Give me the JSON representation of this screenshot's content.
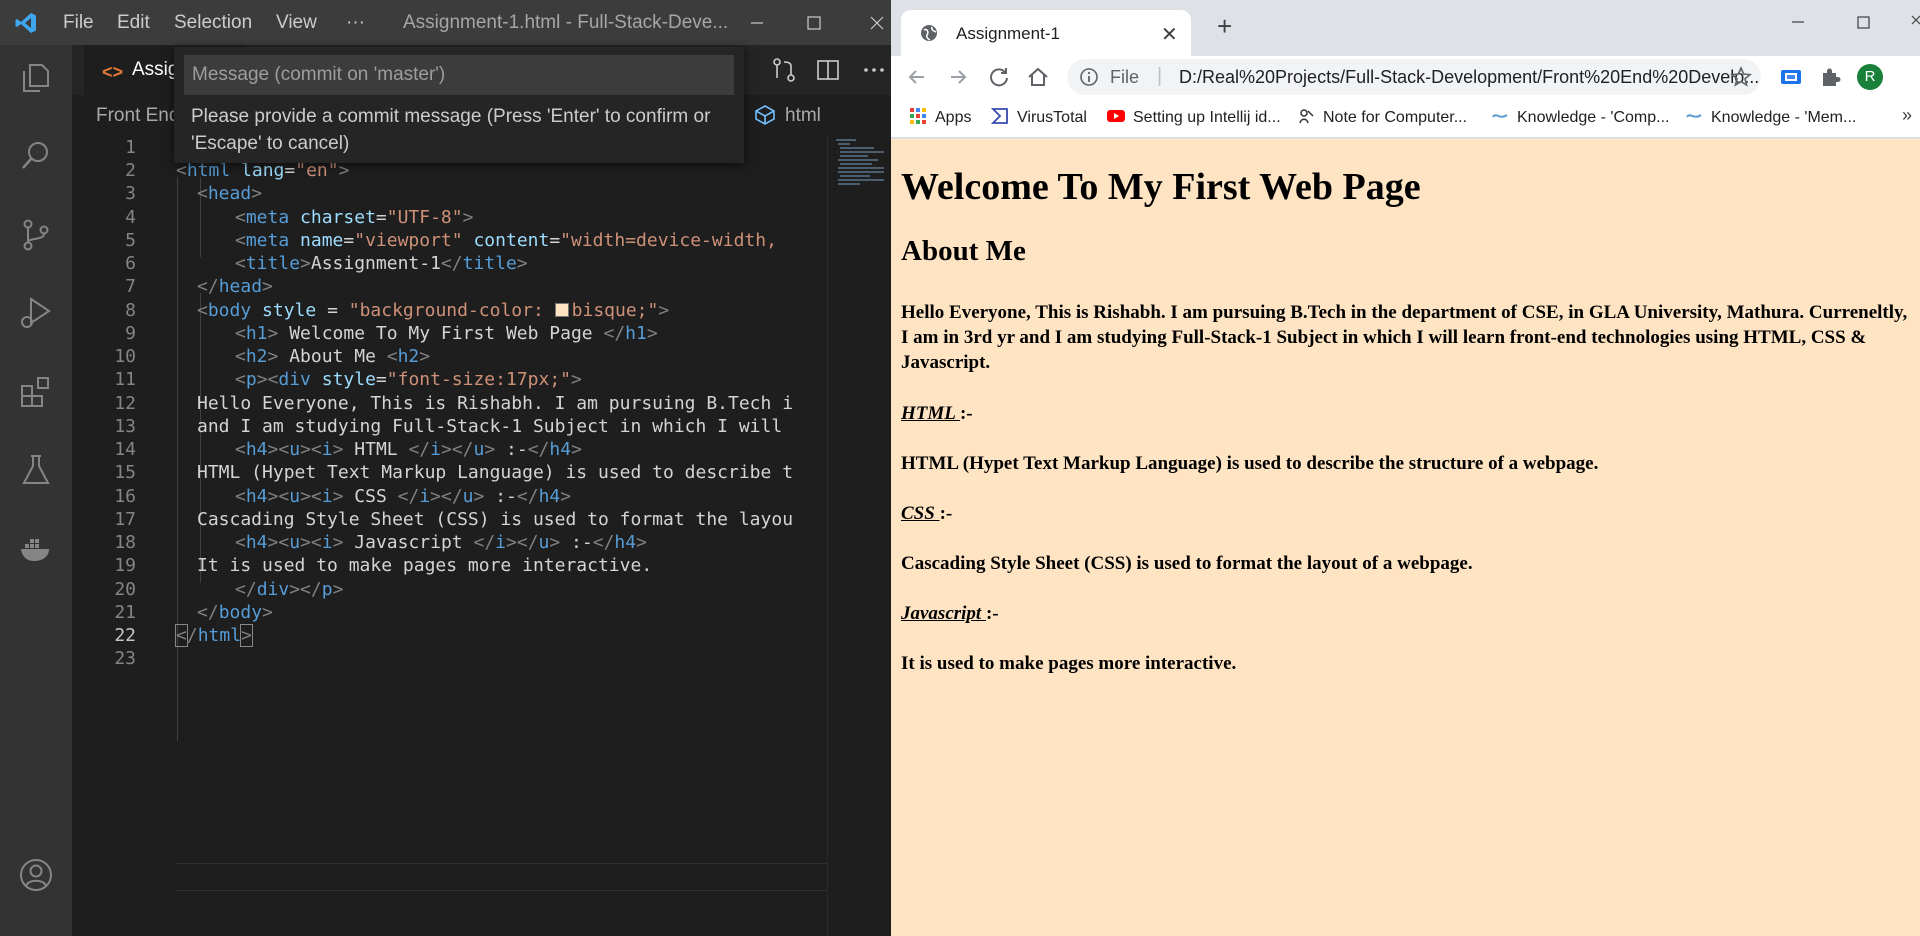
{
  "vscode": {
    "menu": [
      "File",
      "Edit",
      "Selection",
      "View",
      "···"
    ],
    "window_title": "Assignment-1.html - Full-Stack-Deve...",
    "tab_label": "Assign",
    "tab_icon": "<>",
    "breadcrumb_left": "Front End",
    "breadcrumb_right": "html",
    "commit_placeholder": "Message (commit on 'master')",
    "commit_help": "Please provide a commit message (Press 'Enter' to confirm or 'Escape' to cancel)",
    "activity_icons": [
      "explorer-icon",
      "search-icon",
      "source-control-icon",
      "run-debug-icon",
      "extensions-icon",
      "testing-icon",
      "docker-icon",
      "account-icon"
    ],
    "line_numbers": [
      "1",
      "2",
      "3",
      "4",
      "5",
      "6",
      "7",
      "8",
      "9",
      "10",
      "11",
      "12",
      "13",
      "14",
      "15",
      "16",
      "17",
      "18",
      "19",
      "20",
      "21",
      "22",
      "23"
    ],
    "code": {
      "l2_tag": "html",
      "l2_attr": "lang",
      "l2_val": "\"en\"",
      "l3_tag": "head",
      "l4_tag": "meta",
      "l4_attr": "charset",
      "l4_val": "\"UTF-8\"",
      "l5_tag": "meta",
      "l5_attr1": "name",
      "l5_val1": "\"viewport\"",
      "l5_attr2": "content",
      "l5_val2": "\"width=device-width,",
      "l6_tag": "title",
      "l6_text": "Assignment-1",
      "l7_tag": "head",
      "l8_tag": "body",
      "l8_attr": "style",
      "l8_eq": " = ",
      "l8_val1": "\"background-color: ",
      "l8_val2": "bisque;\"",
      "l9_tag": "h1",
      "l9_text": " Welcome To My First Web Page ",
      "l10_tag": "h2",
      "l10_text": " About Me ",
      "l11_tag1": "p",
      "l11_tag2": "div",
      "l11_attr": "style",
      "l11_val": "\"font-size:17px;\"",
      "l12_text": "Hello Everyone, This is Rishabh. I am pursuing B.Tech i",
      "l13_text": "and I am studying Full-Stack-1 Subject in which I will",
      "l14_text": " HTML ",
      "l14_after": " :-",
      "l15_text": "HTML (Hypet Text Markup Language) is used to describe t",
      "l16_text": " CSS ",
      "l16_after": " :-",
      "l17_text": "Cascading Style Sheet (CSS) is used to format the layou",
      "l18_text": " Javascript ",
      "l18_after": " :-",
      "l19_text": "It is used to make pages more interactive.",
      "l20_tag1": "div",
      "l20_tag2": "p",
      "l21_tag": "body",
      "l22_tag": "html"
    }
  },
  "chrome": {
    "tab_title": "Assignment-1",
    "omnibox_scheme": "File",
    "omnibox_sep": "|",
    "url": "D:/Real%20Projects/Full-Stack-Development/Front%20End%20Develo...",
    "avatar_letter": "R",
    "bookmarks": [
      {
        "label": "Apps",
        "icon": "apps-grid-icon"
      },
      {
        "label": "VirusTotal",
        "icon": "virustotal-icon"
      },
      {
        "label": "Setting up Intellij id...",
        "icon": "youtube-icon"
      },
      {
        "label": "Note for Computer...",
        "icon": "note-icon"
      },
      {
        "label": "Knowledge - 'Comp...",
        "icon": "knowledge-icon"
      },
      {
        "label": "Knowledge - 'Mem...",
        "icon": "knowledge-icon"
      }
    ],
    "bookmarks_more": "»"
  },
  "page": {
    "h1": "Welcome To My First Web Page",
    "h2": "About Me",
    "intro": "Hello Everyone, This is Rishabh. I am pursuing B.Tech in the department of CSE, in GLA University, Mathura. Curreneltly, I am in 3rd yr and I am studying Full-Stack-1 Subject in which I will learn front-end technologies using HTML, CSS & Javascript.",
    "html_heading": "HTML ",
    "html_suffix": ":-",
    "html_text": "HTML (Hypet Text Markup Language) is used to describe the structure of a webpage.",
    "css_heading": "CSS ",
    "css_suffix": ":-",
    "css_text": "Cascading Style Sheet (CSS) is used to format the layout of a webpage.",
    "js_heading": "Javascript ",
    "js_suffix": ":-",
    "js_text": "It is used to make pages more interactive.",
    "background_color": "#ffe4c4"
  }
}
